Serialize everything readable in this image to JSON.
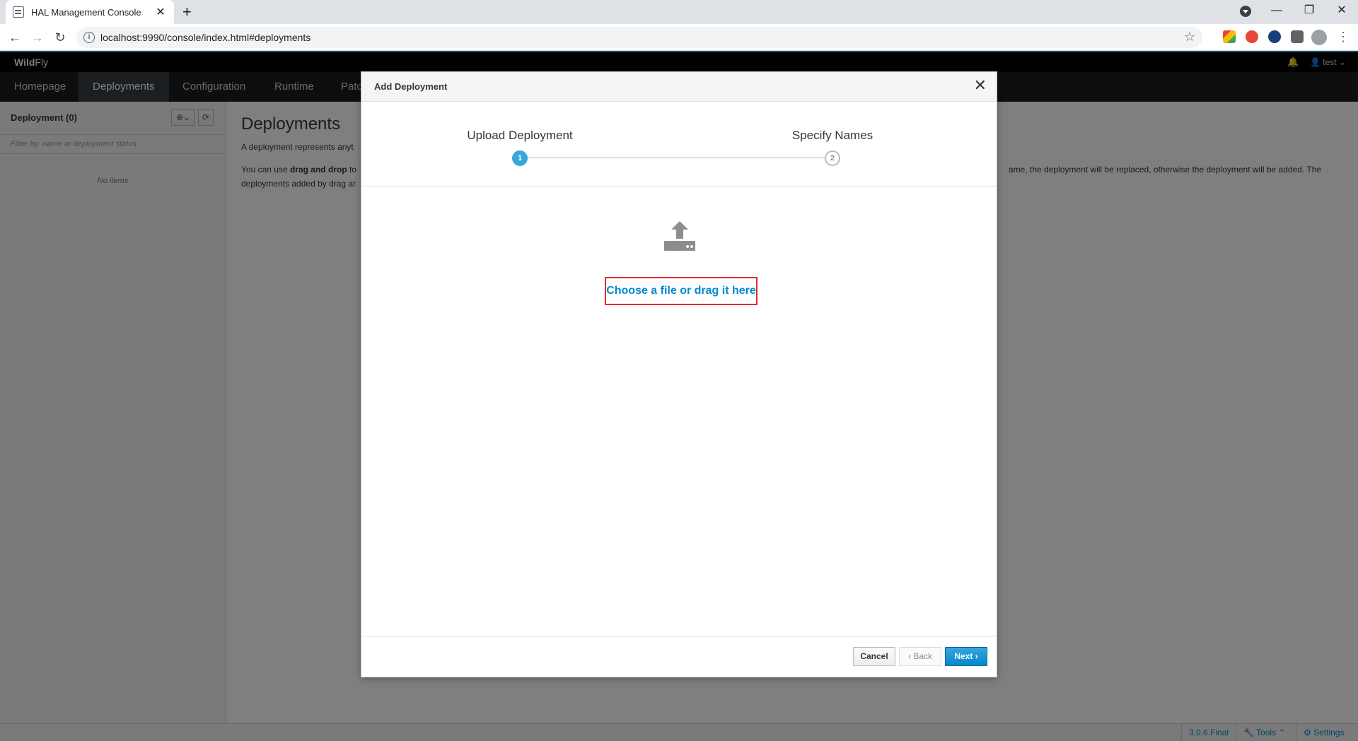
{
  "browser": {
    "tab_title": "HAL Management Console",
    "url": "localhost:9990/console/index.html#deployments"
  },
  "header": {
    "brand_bold": "Wild",
    "brand_rest": "Fly",
    "user": "test"
  },
  "nav": {
    "items": [
      "Homepage",
      "Deployments",
      "Configuration",
      "Runtime",
      "Patc"
    ]
  },
  "left_pane": {
    "title": "Deployment (0)",
    "filter_placeholder": "Filter by: name or deployment status",
    "empty_text": "No items"
  },
  "main": {
    "title": "Deployments",
    "p1": "A deployment represents anyt",
    "p2_a": "You can use ",
    "p2_bold": "drag and drop",
    "p2_b": " to",
    "p2_right": "ame, the deployment will be replaced, otherwise the deployment will be added. The",
    "p2_line2": "deployments added by drag ar"
  },
  "modal": {
    "title": "Add Deployment",
    "steps": [
      {
        "number": "1",
        "label": "Upload Deployment",
        "active": true
      },
      {
        "number": "2",
        "label": "Specify Names",
        "active": false
      }
    ],
    "choose_link": "Choose a file or drag it here",
    "cancel_label": "Cancel",
    "back_label": "‹ Back",
    "next_label": "Next ›"
  },
  "footer": {
    "version": "3.0.6.Final",
    "tools": "Tools",
    "settings": "Settings"
  },
  "colors": {
    "accent": "#0088ce",
    "step_active": "#39a5dc",
    "highlight": "#e12b2b"
  }
}
